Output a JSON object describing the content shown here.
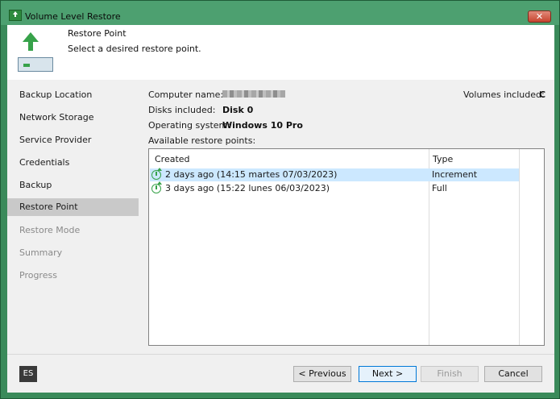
{
  "window": {
    "title": "Volume Level Restore",
    "close_label": "✕"
  },
  "header": {
    "title": "Restore Point",
    "subtitle": "Select a desired restore point."
  },
  "sidebar": {
    "items": [
      {
        "label": "Backup Location",
        "state": "normal"
      },
      {
        "label": "Network Storage",
        "state": "normal"
      },
      {
        "label": "Service Provider",
        "state": "normal"
      },
      {
        "label": "Credentials",
        "state": "normal"
      },
      {
        "label": "Backup",
        "state": "normal"
      },
      {
        "label": "Restore Point",
        "state": "active"
      },
      {
        "label": "Restore Mode",
        "state": "disabled"
      },
      {
        "label": "Summary",
        "state": "disabled"
      },
      {
        "label": "Progress",
        "state": "disabled"
      }
    ]
  },
  "info": {
    "computer_name_label": "Computer name:",
    "volumes_label": "Volumes included:",
    "volumes_value": "C",
    "disks_label": "Disks included:",
    "disks_value": "Disk 0",
    "os_label": "Operating system:",
    "os_value": "Windows 10 Pro",
    "available_label": "Available restore points:"
  },
  "restore_points": {
    "columns": [
      "Created",
      "Type"
    ],
    "rows": [
      {
        "created": "2 days ago (14:15 martes 07/03/2023)",
        "type": "Increment",
        "selected": true
      },
      {
        "created": "3 days ago (15:22 lunes 06/03/2023)",
        "type": "Full",
        "selected": false
      }
    ]
  },
  "footer": {
    "language": "ES",
    "previous": "< Previous",
    "next": "Next >",
    "finish": "Finish",
    "cancel": "Cancel"
  },
  "colors": {
    "accent_green": "#37a24a",
    "selection": "#cce8ff",
    "title_bar": "#4da070"
  }
}
